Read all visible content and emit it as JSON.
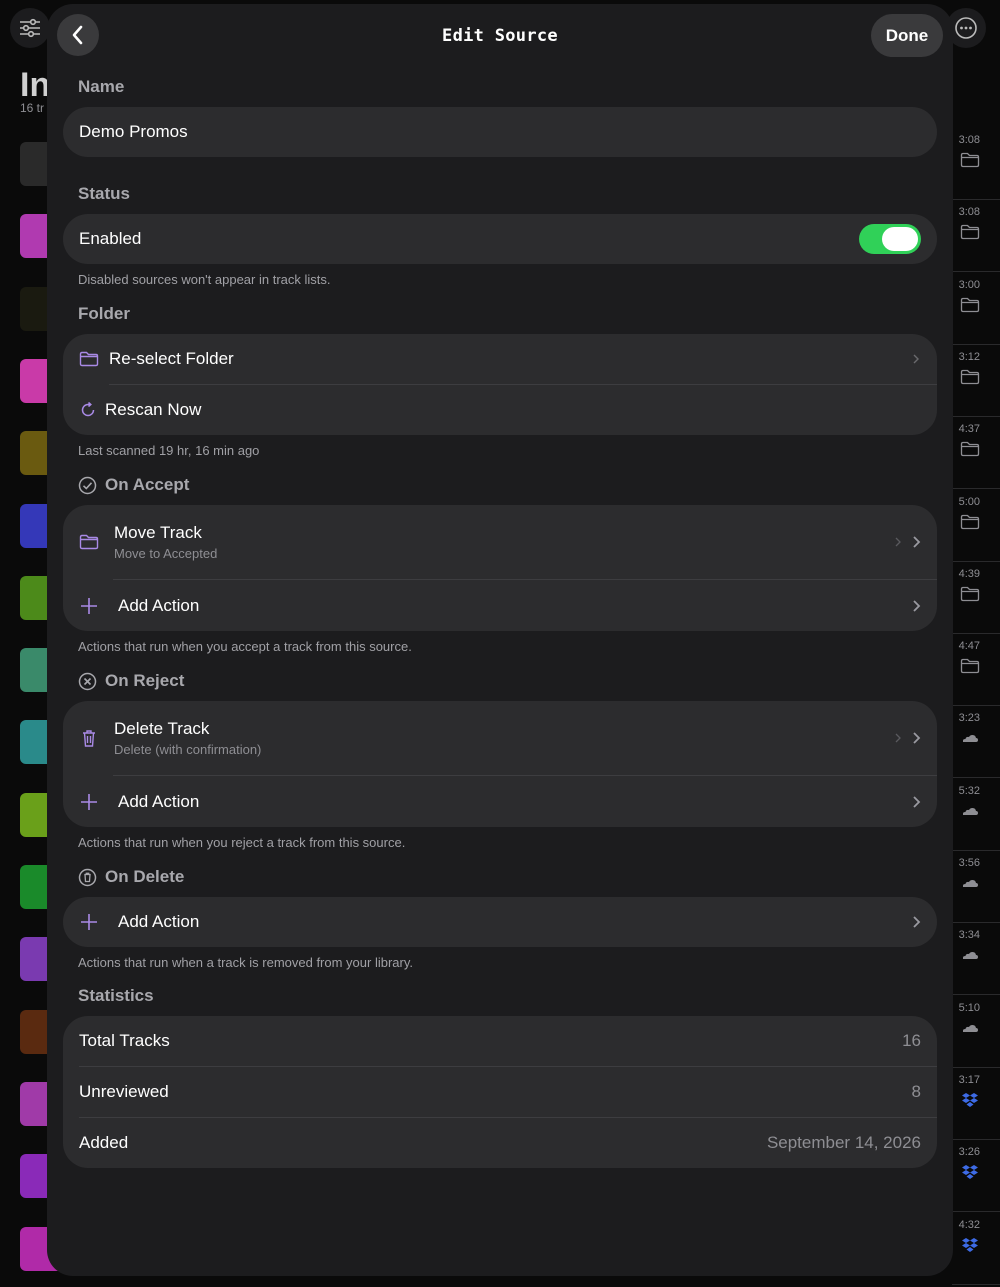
{
  "background": {
    "title": "In",
    "subtitle": "16 tr",
    "rows": [
      {
        "duration": "3:08",
        "thumb": "#2a2a2a",
        "source": "folder"
      },
      {
        "duration": "3:08",
        "thumb": "#b03ab0",
        "source": "folder"
      },
      {
        "duration": "3:00",
        "thumb": "#1a1a10",
        "source": "folder"
      },
      {
        "duration": "3:12",
        "thumb": "#c93aa8",
        "source": "folder"
      },
      {
        "duration": "4:37",
        "thumb": "#6a5a10",
        "source": "folder"
      },
      {
        "duration": "5:00",
        "thumb": "#3438b8",
        "source": "folder"
      },
      {
        "duration": "4:39",
        "thumb": "#4c8a1a",
        "source": "folder"
      },
      {
        "duration": "4:47",
        "thumb": "#3a8a6a",
        "source": "folder"
      },
      {
        "duration": "3:23",
        "thumb": "#2a8a8a",
        "source": "cloud"
      },
      {
        "duration": "5:32",
        "thumb": "#6aa01a",
        "source": "cloud"
      },
      {
        "duration": "3:56",
        "thumb": "#1a8a2a",
        "source": "cloud"
      },
      {
        "duration": "3:34",
        "thumb": "#7a3ab0",
        "source": "cloud"
      },
      {
        "duration": "5:10",
        "thumb": "#5a2a10",
        "source": "cloud"
      },
      {
        "duration": "3:17",
        "thumb": "#a03aa8",
        "source": "dropbox"
      },
      {
        "duration": "3:26",
        "thumb": "#8a2ab8",
        "source": "dropbox"
      },
      {
        "duration": "4:32",
        "thumb": "#b02aa8",
        "source": "dropbox"
      }
    ]
  },
  "header": {
    "title": "Edit Source",
    "done_label": "Done"
  },
  "name_section": {
    "label": "Name",
    "value": "Demo Promos"
  },
  "status_section": {
    "label": "Status",
    "enabled_label": "Enabled",
    "enabled": true,
    "footnote": "Disabled sources won't appear in track lists."
  },
  "folder_section": {
    "label": "Folder",
    "reselect_label": "Re-select Folder",
    "rescan_label": "Rescan Now",
    "footnote": "Last scanned 19 hr, 16 min ago"
  },
  "on_accept": {
    "label": "On Accept",
    "action_title": "Move Track",
    "action_subtitle": "Move to Accepted",
    "add_label": "Add Action",
    "footnote": "Actions that run when you accept a track from this source."
  },
  "on_reject": {
    "label": "On Reject",
    "action_title": "Delete Track",
    "action_subtitle": "Delete (with confirmation)",
    "add_label": "Add Action",
    "footnote": "Actions that run when you reject a track from this source."
  },
  "on_delete": {
    "label": "On Delete",
    "add_label": "Add Action",
    "footnote": "Actions that run when a track is removed from your library."
  },
  "statistics": {
    "label": "Statistics",
    "total_label": "Total Tracks",
    "total_value": "16",
    "unreviewed_label": "Unreviewed",
    "unreviewed_value": "8",
    "added_label": "Added",
    "added_value": "September 14, 2026"
  },
  "colors": {
    "accent": "#a98ae6",
    "toggle_on": "#30d158",
    "sheet_bg": "#1c1c1e",
    "group_bg": "#2c2c2e"
  }
}
